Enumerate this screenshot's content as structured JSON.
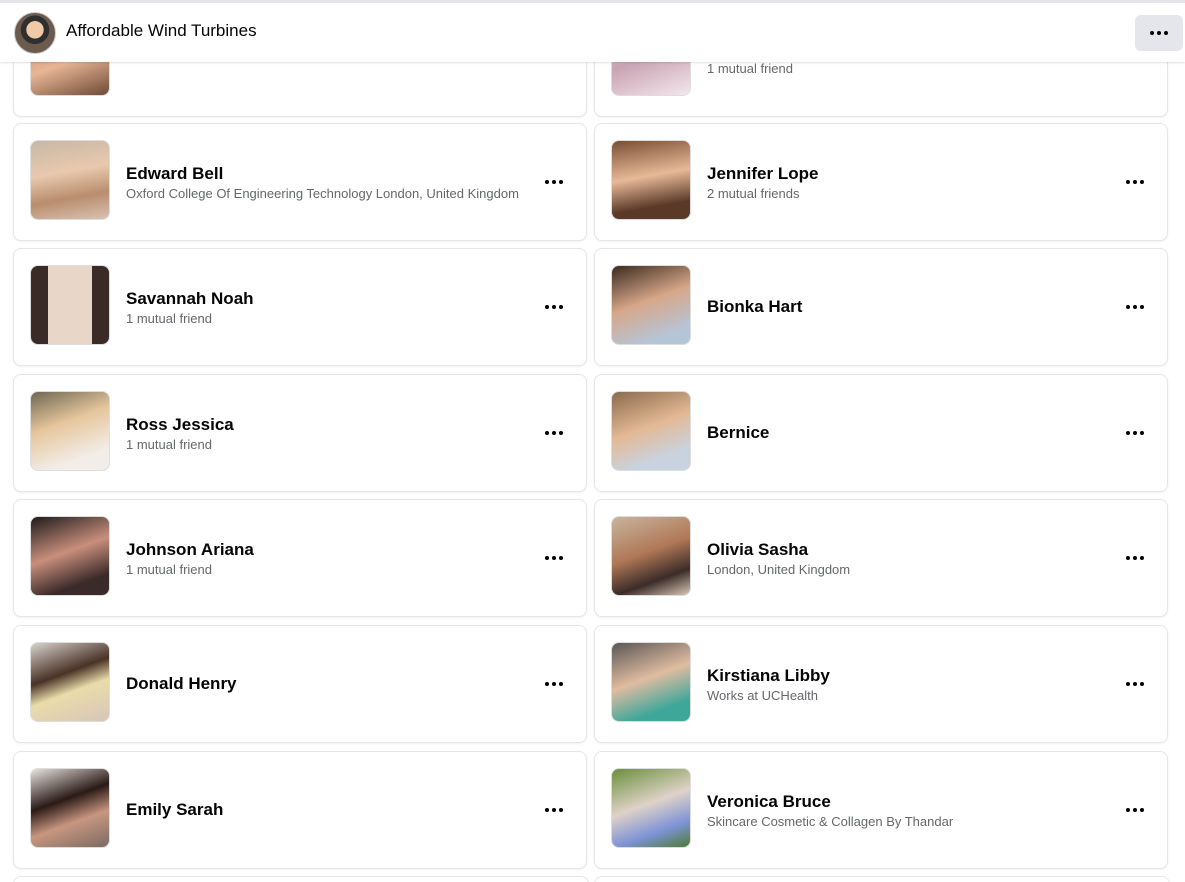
{
  "header": {
    "title": "Affordable Wind Turbines"
  },
  "cards": [
    {
      "name": "",
      "sub": ""
    },
    {
      "name": "",
      "sub": "1 mutual friend"
    },
    {
      "name": "Edward Bell",
      "sub": "Oxford College Of Engineering Technology London, United Kingdom"
    },
    {
      "name": "Jennifer Lope",
      "sub": "2 mutual friends"
    },
    {
      "name": "Savannah Noah",
      "sub": "1 mutual friend"
    },
    {
      "name": "Bionka Hart",
      "sub": ""
    },
    {
      "name": "Ross Jessica",
      "sub": "1 mutual friend"
    },
    {
      "name": "Bernice",
      "sub": ""
    },
    {
      "name": "Johnson Ariana",
      "sub": "1 mutual friend"
    },
    {
      "name": "Olivia Sasha",
      "sub": "London, United Kingdom"
    },
    {
      "name": "Donald Henry",
      "sub": ""
    },
    {
      "name": "Kirstiana Libby",
      "sub": "Works at UCHealth"
    },
    {
      "name": "Emily Sarah",
      "sub": ""
    },
    {
      "name": "Veronica Bruce",
      "sub": "Skincare Cosmetic & Collagen By Thandar"
    }
  ],
  "icons": {
    "more": "more-dots-icon",
    "avatar": "profile-photo"
  }
}
